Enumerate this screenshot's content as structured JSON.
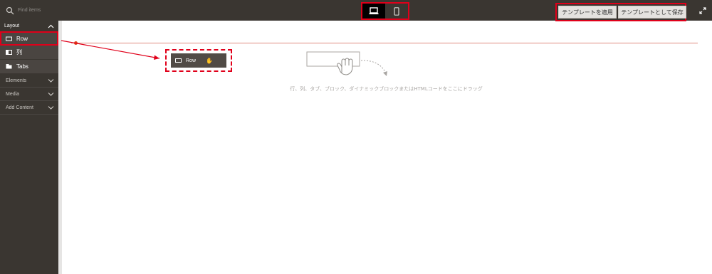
{
  "search": {
    "placeholder": "Find items"
  },
  "header": {
    "apply_template": "テンプレートを適用",
    "save_template": "テンプレートとして保存"
  },
  "sidebar": {
    "layout_title": "Layout",
    "layout_items": [
      {
        "label": "Row",
        "icon": "row-icon"
      },
      {
        "label": "列",
        "icon": "column-icon"
      },
      {
        "label": "Tabs",
        "icon": "tabs-icon"
      }
    ],
    "categories": [
      {
        "label": "Elements"
      },
      {
        "label": "Media"
      },
      {
        "label": "Add Content"
      }
    ]
  },
  "stage": {
    "dragging_label": "Row",
    "hint": "行、列、タブ、ブロック、ダイナミックブロックまたはHTMLコードをここにドラッグ"
  },
  "colors": {
    "highlight": "#e0001a",
    "sidebar_bg": "#3a3631",
    "topbar_bg": "#3a3631"
  }
}
